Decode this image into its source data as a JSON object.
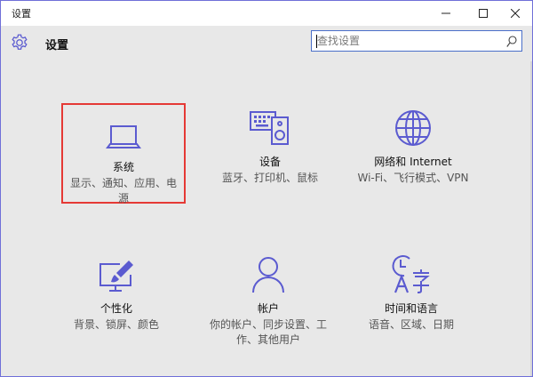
{
  "window": {
    "title": "设置"
  },
  "header": {
    "title": "设置",
    "search_placeholder": "查找设置"
  },
  "tiles": [
    {
      "name": "系统",
      "desc": "显示、通知、应用、电源",
      "icon": "laptop-icon"
    },
    {
      "name": "设备",
      "desc": "蓝牙、打印机、鼠标",
      "icon": "keyboard-speaker-icon"
    },
    {
      "name": "网络和 Internet",
      "desc": "Wi-Fi、飞行模式、VPN",
      "icon": "globe-icon"
    },
    {
      "name": "个性化",
      "desc": "背景、锁屏、颜色",
      "icon": "paint-monitor-icon"
    },
    {
      "name": "帐户",
      "desc": "你的帐户、同步设置、工作、其他用户",
      "icon": "person-icon"
    },
    {
      "name": "时间和语言",
      "desc": "语音、区域、日期",
      "icon": "time-language-icon"
    }
  ],
  "colors": {
    "accent": "#5b5bd0",
    "selected_border": "#e53935",
    "search_border": "#4a6fc9"
  }
}
